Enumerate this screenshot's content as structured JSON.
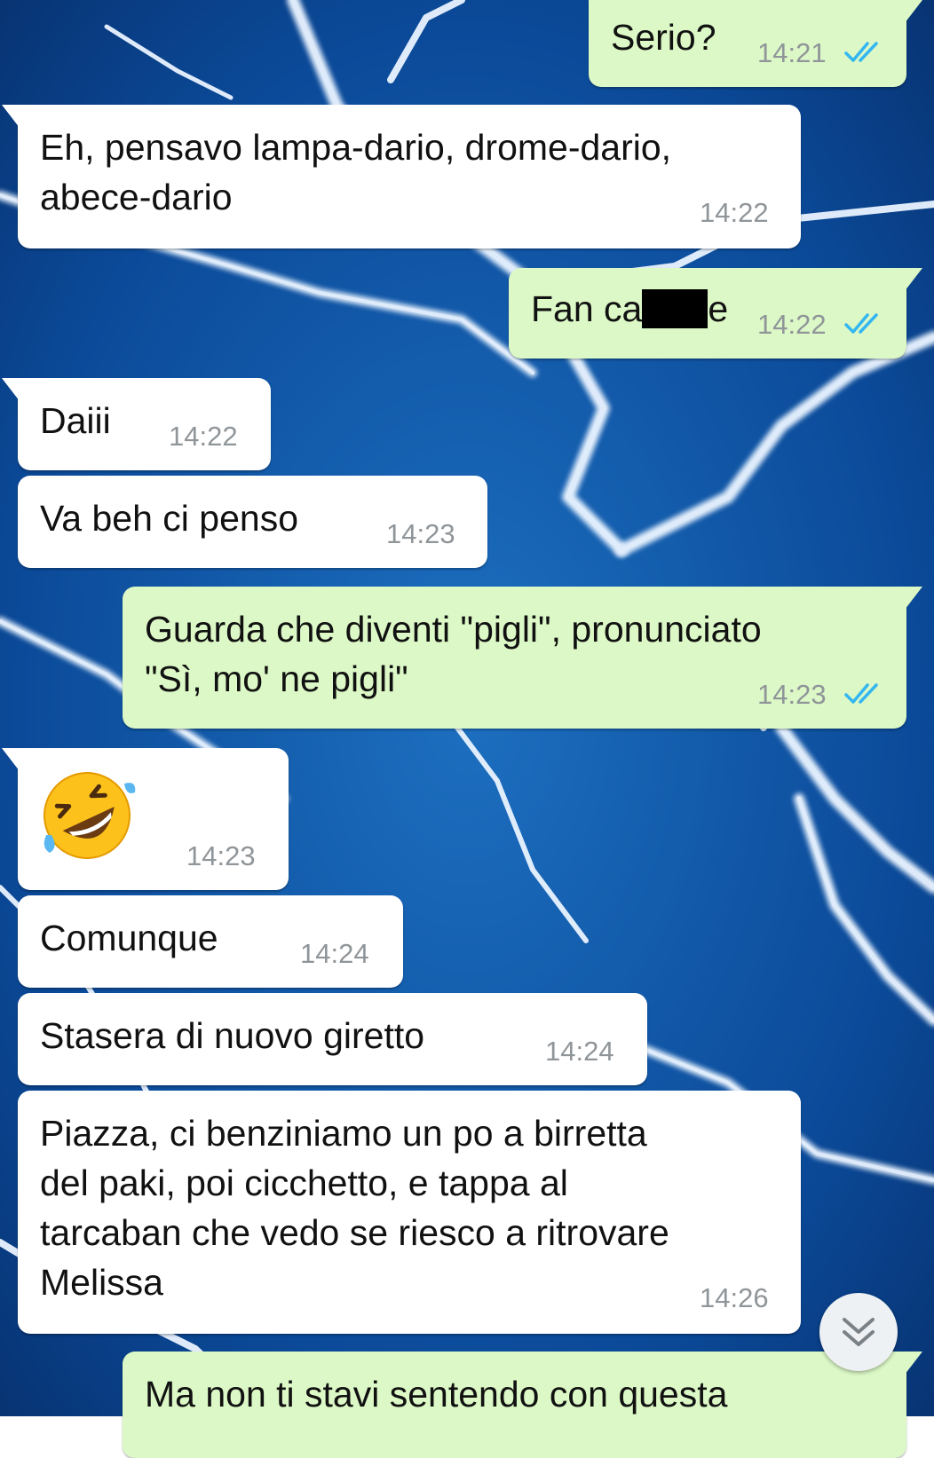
{
  "colors": {
    "incoming_bubble": "#ffffff",
    "outgoing_bubble": "#dcf8c6",
    "read_ticks": "#34b7f1",
    "timestamp": "#8f9599",
    "wallpaper_base": "#0a3d82"
  },
  "messages": [
    {
      "direction": "outgoing",
      "text": "Serio?",
      "time": "14:21",
      "status": "read"
    },
    {
      "direction": "incoming",
      "lines": [
        "Eh, pensavo lampa-dario, drome-dario,",
        "abece-dario"
      ],
      "time": "14:22"
    },
    {
      "direction": "outgoing",
      "text_before": "Fan ca",
      "text_after": "e",
      "redacted": true,
      "time": "14:22",
      "status": "read"
    },
    {
      "direction": "incoming",
      "text": "Daiii",
      "time": "14:22"
    },
    {
      "direction": "incoming",
      "text": "Va beh ci penso",
      "time": "14:23"
    },
    {
      "direction": "outgoing",
      "lines": [
        "Guarda che diventi \"pigli\", pronunciato",
        "\"Sì, mo' ne pigli\""
      ],
      "time": "14:23",
      "status": "read"
    },
    {
      "direction": "incoming",
      "emoji": "rolling-on-floor-laughing",
      "time": "14:23"
    },
    {
      "direction": "incoming",
      "text": "Comunque",
      "time": "14:24"
    },
    {
      "direction": "incoming",
      "text": "Stasera di nuovo giretto",
      "time": "14:24"
    },
    {
      "direction": "incoming",
      "lines": [
        "Piazza, ci benziniamo un po a birretta",
        "del paki, poi cicchetto, e tappa al",
        "tarcaban che vedo se riesco a ritrovare",
        "Melissa"
      ],
      "time": "14:26"
    },
    {
      "direction": "outgoing",
      "text": "Ma non ti stavi sentendo con questa",
      "partial": true
    }
  ],
  "icons": {
    "read_receipt": "double-check-icon",
    "scroll_down": "chevron-double-down-icon",
    "emoji": "rofl-emoji-icon"
  }
}
